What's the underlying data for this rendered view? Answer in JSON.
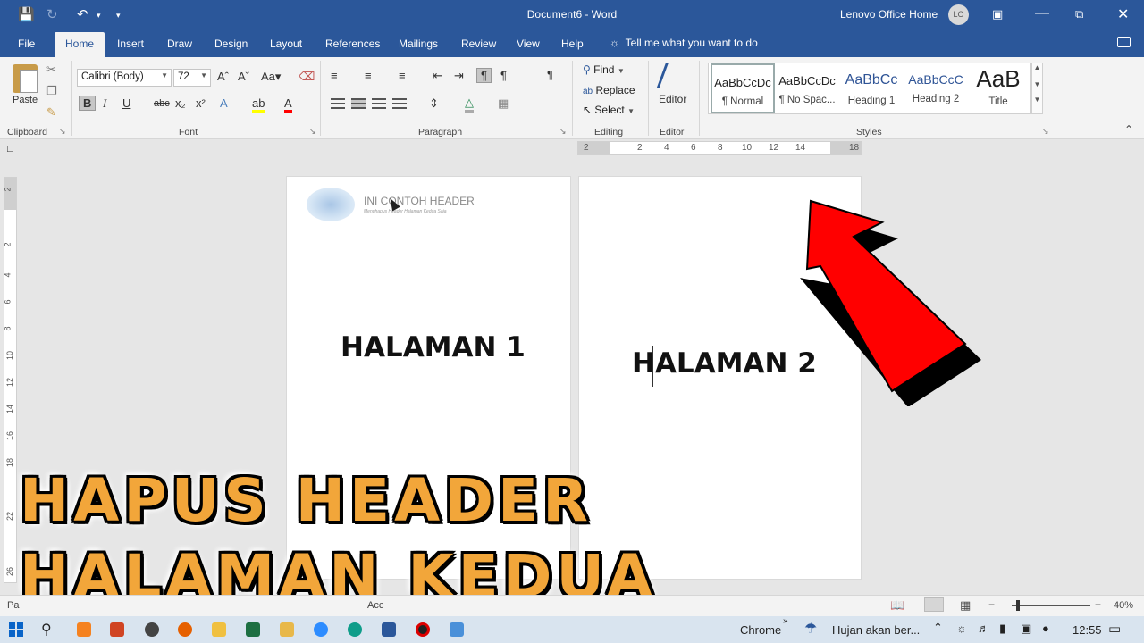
{
  "window": {
    "title": "Document6 - Word",
    "account": "Lenovo Office Home",
    "avatar_initials": "LO"
  },
  "tabs": [
    "File",
    "Home",
    "Insert",
    "Draw",
    "Design",
    "Layout",
    "References",
    "Mailings",
    "Review",
    "View",
    "Help"
  ],
  "active_tab": "Home",
  "tell_me": "Tell me what you want to do",
  "ribbon": {
    "clipboard": {
      "paste": "Paste",
      "label": "Clipboard"
    },
    "font": {
      "name": "Calibri (Body)",
      "size": "72",
      "label": "Font"
    },
    "paragraph": {
      "label": "Paragraph"
    },
    "editing": {
      "find": "Find",
      "replace": "Replace",
      "select": "Select",
      "label": "Editing"
    },
    "editor": {
      "button": "Editor",
      "label": "Editor"
    },
    "styles": {
      "label": "Styles",
      "items": [
        {
          "sample": "AaBbCcDc",
          "name": "¶ Normal"
        },
        {
          "sample": "AaBbCcDc",
          "name": "¶ No Spac..."
        },
        {
          "sample": "AaBbCc",
          "name": "Heading 1"
        },
        {
          "sample": "AaBbCcC",
          "name": "Heading 2"
        },
        {
          "sample": "AaB",
          "name": "Title"
        }
      ]
    }
  },
  "ruler_numbers": [
    "2",
    "2",
    "4",
    "6",
    "8",
    "10",
    "12",
    "14",
    "18"
  ],
  "vruler_numbers": [
    "2",
    "2",
    "4",
    "6",
    "8",
    "10",
    "12",
    "14",
    "16",
    "18",
    "22",
    "26"
  ],
  "document": {
    "page1": {
      "header_title": "INI CONTOH HEADER",
      "header_subtitle": "Menghapus Header Halaman Kedua Saja",
      "body": "HALAMAN 1"
    },
    "page2": {
      "body": "HALAMAN 2"
    }
  },
  "overlay": {
    "line1": "HAPUS  HEADER",
    "line2": "HALAMAN  KEDUA"
  },
  "statusbar": {
    "left": "Pa",
    "accessibility": "Acc",
    "zoom": "40%",
    "minus": "−",
    "plus": "+"
  },
  "taskbar": {
    "chrome": "Chrome",
    "weather": "Hujan akan ber...",
    "time": "12:55"
  },
  "colors": {
    "word_blue": "#2b579a",
    "overlay_orange": "#f2a63a",
    "arrow_red": "#ff0000"
  }
}
